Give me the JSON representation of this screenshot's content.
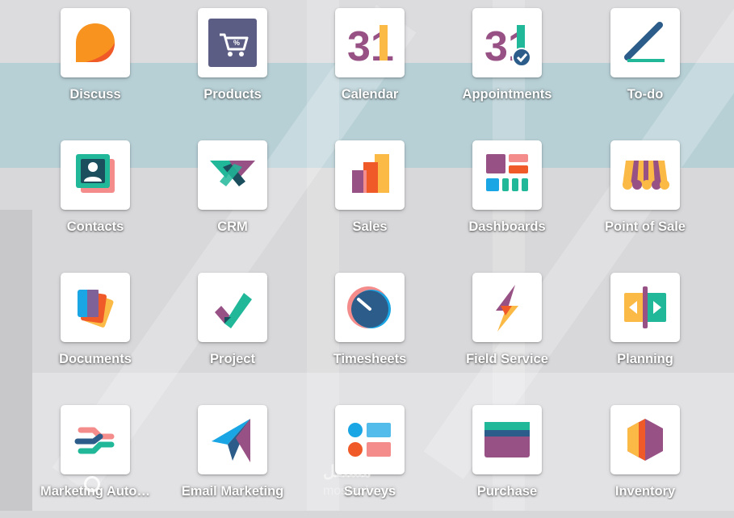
{
  "apps": [
    {
      "label": "Discuss",
      "icon": "discuss-icon"
    },
    {
      "label": "Products",
      "icon": "products-icon"
    },
    {
      "label": "Calendar",
      "icon": "calendar-icon"
    },
    {
      "label": "Appointments",
      "icon": "appointments-icon"
    },
    {
      "label": "To-do",
      "icon": "todo-icon"
    },
    {
      "label": "Contacts",
      "icon": "contacts-icon"
    },
    {
      "label": "CRM",
      "icon": "crm-icon"
    },
    {
      "label": "Sales",
      "icon": "sales-icon"
    },
    {
      "label": "Dashboards",
      "icon": "dashboards-icon"
    },
    {
      "label": "Point of Sale",
      "icon": "point-of-sale-icon"
    },
    {
      "label": "Documents",
      "icon": "documents-icon"
    },
    {
      "label": "Project",
      "icon": "project-icon"
    },
    {
      "label": "Timesheets",
      "icon": "timesheets-icon"
    },
    {
      "label": "Field Service",
      "icon": "field-service-icon"
    },
    {
      "label": "Planning",
      "icon": "planning-icon"
    },
    {
      "label": "Marketing Auto…",
      "icon": "marketing-automation-icon"
    },
    {
      "label": "Email Marketing",
      "icon": "email-marketing-icon"
    },
    {
      "label": "Surveys",
      "icon": "surveys-icon"
    },
    {
      "label": "Purchase",
      "icon": "purchase-icon"
    },
    {
      "label": "Inventory",
      "icon": "inventory-icon"
    }
  ],
  "icon_text": {
    "calendar_day": "31",
    "appointments_day": "31",
    "products_badge": "%"
  },
  "watermark": {
    "logo": "مستقل",
    "site": "mostaql.com"
  },
  "colors": {
    "orange": "#F7931E",
    "purple": "#985184",
    "teal": "#21B799",
    "pink": "#F48C8C",
    "yellow": "#FBB945",
    "blue": "#1AA5E4",
    "dark_blue": "#2C5D8A"
  }
}
